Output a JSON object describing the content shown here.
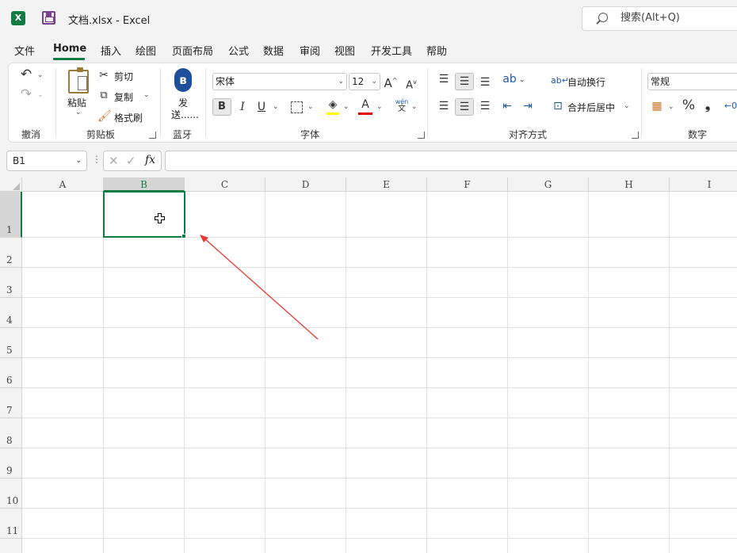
{
  "titlebar": {
    "app_logo": "X",
    "window_title": "文档.xlsx  -  Excel",
    "search_placeholder": "搜索(Alt+Q)"
  },
  "menu": {
    "tabs": [
      "文件",
      "Home",
      "插入",
      "绘图",
      "页面布局",
      "公式",
      "数据",
      "审阅",
      "视图",
      "开发工具",
      "帮助"
    ],
    "active_tab": "Home"
  },
  "ribbon": {
    "undo": {
      "label": "撤消"
    },
    "clipboard": {
      "label": "剪贴板",
      "paste": "粘贴",
      "cut": "剪切",
      "copy": "复制",
      "format_painter": "格式刷"
    },
    "bluetooth": {
      "label": "蓝牙",
      "send_line1": "发",
      "send_line2": "送......"
    },
    "font": {
      "label": "字体",
      "font_name": "宋体",
      "font_size": "12",
      "bold": "B",
      "italic": "I",
      "underline": "U",
      "phonetic_top": "wén",
      "phonetic_bottom": "文",
      "font_color": "A",
      "fill_color_hex": "#ffff00",
      "font_color_hex": "#e00000"
    },
    "alignment": {
      "label": "对齐方式",
      "wrap_text": "自动换行",
      "merge_center": "合并后居中"
    },
    "number": {
      "label": "数字",
      "format": "常规",
      "percent": "%",
      "comma": "❟"
    }
  },
  "formula_bar": {
    "name_box": "B1",
    "fx": "fx",
    "value": ""
  },
  "grid": {
    "columns": [
      "A",
      "B",
      "C",
      "D",
      "E",
      "F",
      "G",
      "H",
      "I"
    ],
    "rows": [
      "1",
      "2",
      "3",
      "4",
      "5",
      "6",
      "7",
      "8",
      "9",
      "10",
      "11"
    ],
    "selected_cell": "B1",
    "accent_color": "#107c41",
    "annotation_color": "#e53935"
  }
}
